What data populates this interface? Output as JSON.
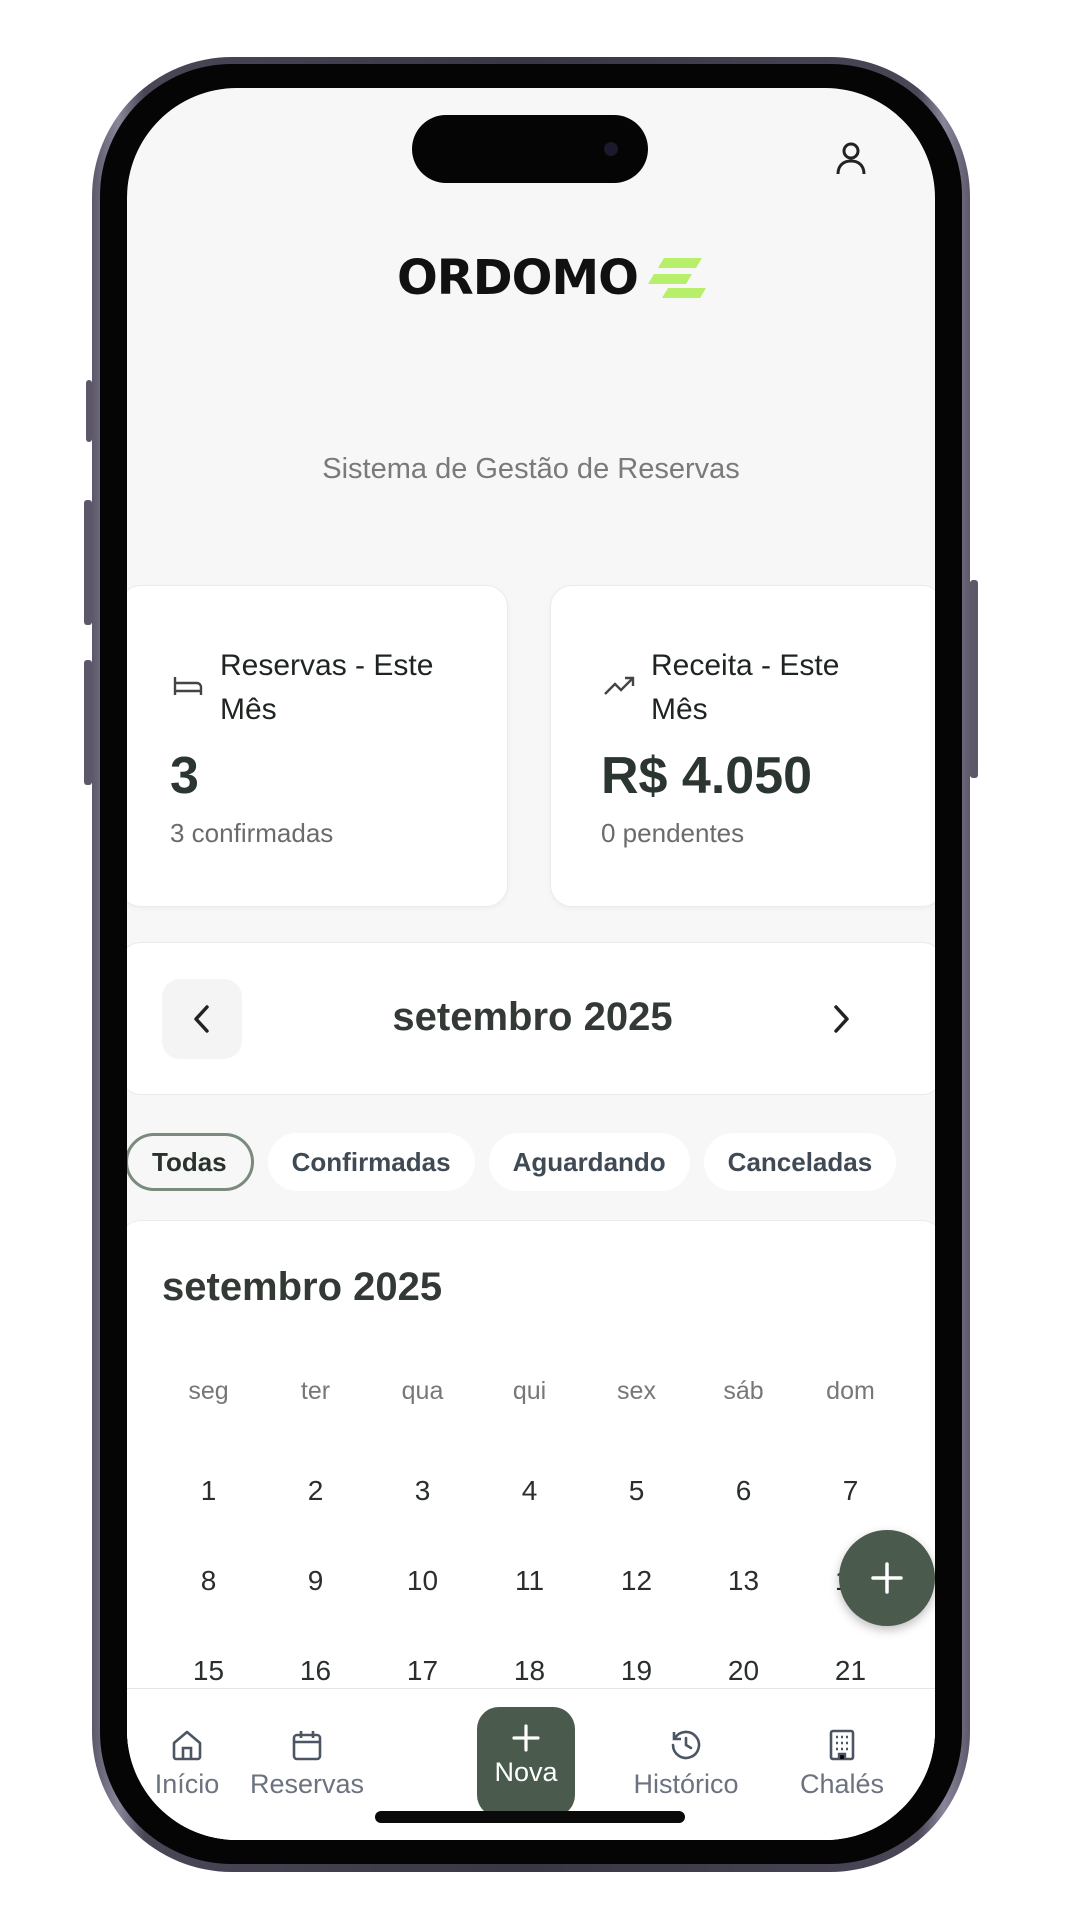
{
  "app": {
    "logo_text": "ORDOMO",
    "subtitle": "Sistema de Gestão de Reservas",
    "brand_colors": {
      "primary": "#4a5a4c",
      "accent": "#b7ef6b"
    }
  },
  "stats": [
    {
      "icon": "bed-icon",
      "label": "Reservas - Este Mês",
      "value": "3",
      "sub": "3 confirmadas"
    },
    {
      "icon": "trending-up-icon",
      "label": "Receita - Este Mês",
      "value": "R$ 4.050",
      "sub": "0 pendentes"
    }
  ],
  "month_nav": {
    "title": "setembro 2025",
    "prev_icon": "chevron-left-icon",
    "next_icon": "chevron-right-icon"
  },
  "filters": [
    {
      "label": "Todas",
      "active": true
    },
    {
      "label": "Confirmadas",
      "active": false
    },
    {
      "label": "Aguardando",
      "active": false
    },
    {
      "label": "Canceladas",
      "active": false
    }
  ],
  "calendar": {
    "title": "setembro 2025",
    "weekdays": [
      "seg",
      "ter",
      "qua",
      "qui",
      "sex",
      "sáb",
      "dom"
    ],
    "weeks": [
      [
        "1",
        "2",
        "3",
        "4",
        "5",
        "6",
        "7"
      ],
      [
        "8",
        "9",
        "10",
        "11",
        "12",
        "13",
        "14"
      ],
      [
        "15",
        "16",
        "17",
        "18",
        "19",
        "20",
        "21"
      ]
    ]
  },
  "tabbar": {
    "items": [
      {
        "label": "Início",
        "icon": "home-icon"
      },
      {
        "label": "Reservas",
        "icon": "calendar-icon"
      },
      {
        "label": "Nova",
        "icon": "plus-icon"
      },
      {
        "label": "Histórico",
        "icon": "history-icon"
      },
      {
        "label": "Chalés",
        "icon": "building-icon"
      }
    ]
  }
}
